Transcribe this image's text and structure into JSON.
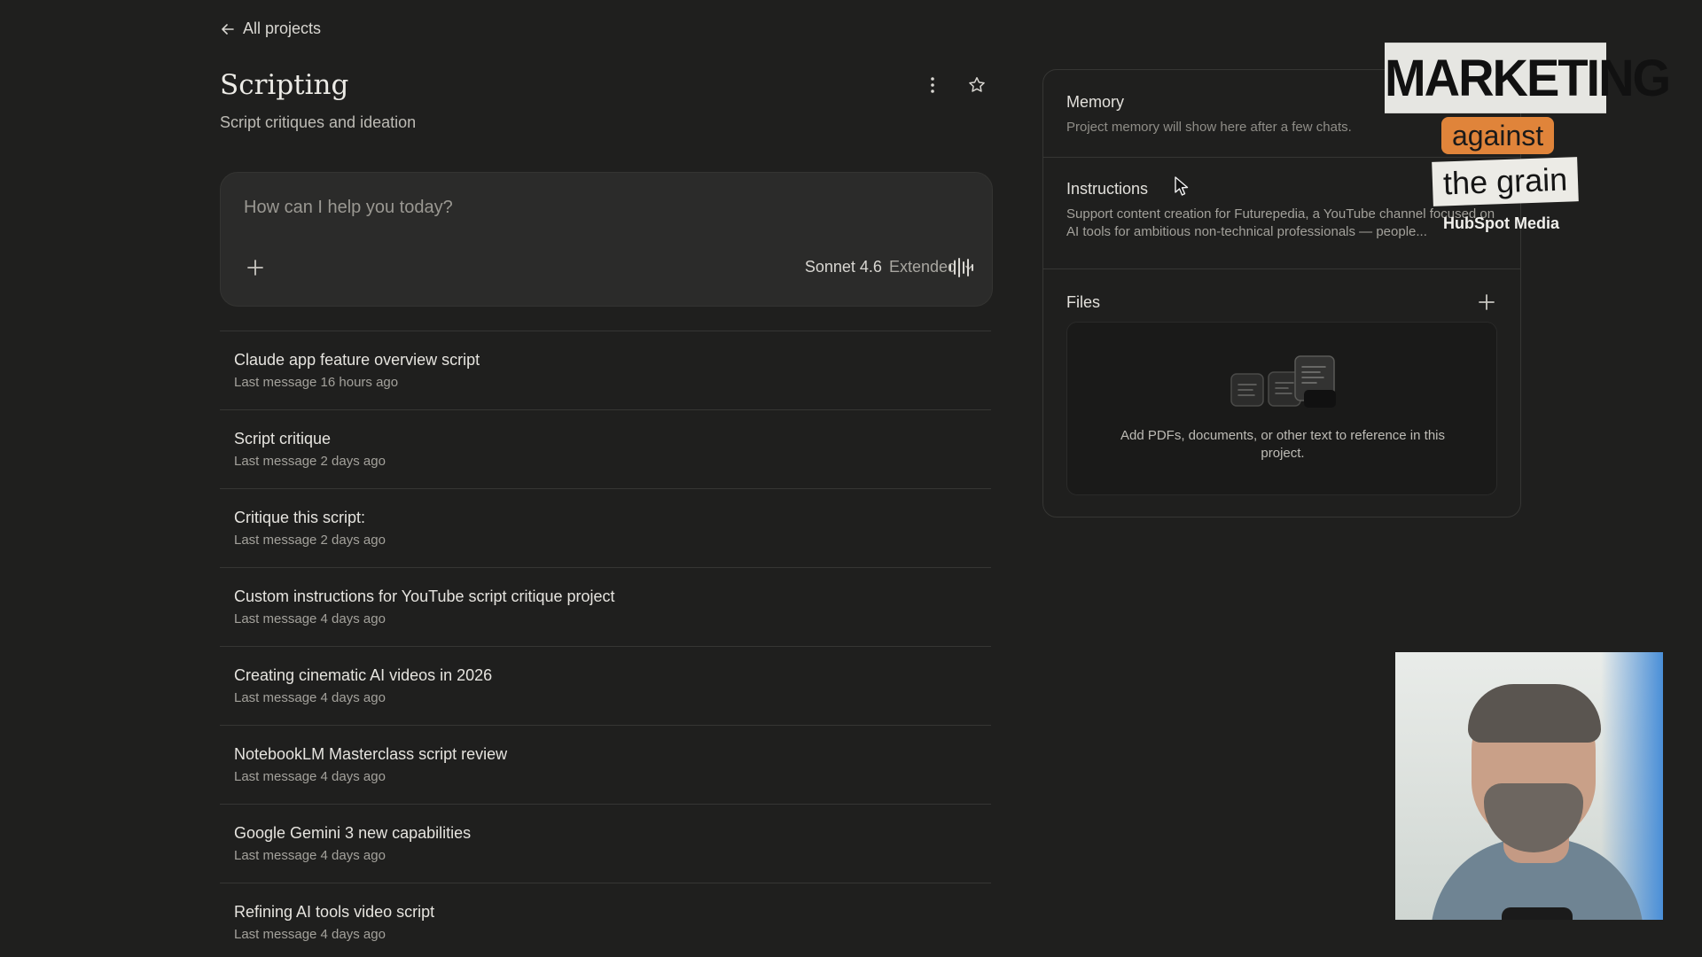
{
  "nav": {
    "back_label": "All projects"
  },
  "project": {
    "title": "Scripting",
    "description": "Script critiques and ideation"
  },
  "composer": {
    "placeholder": "How can I help you today?",
    "model_name": "Sonnet 4.6",
    "model_mode": "Extended"
  },
  "chats": [
    {
      "title": "Claude app feature overview script",
      "meta": "Last message 16 hours ago"
    },
    {
      "title": "Script critique",
      "meta": "Last message 2 days ago"
    },
    {
      "title": "Critique this script:",
      "meta": "Last message 2 days ago"
    },
    {
      "title": "Custom instructions for YouTube script critique project",
      "meta": "Last message 4 days ago"
    },
    {
      "title": "Creating cinematic AI videos in 2026",
      "meta": "Last message 4 days ago"
    },
    {
      "title": "NotebookLM Masterclass script review",
      "meta": "Last message 4 days ago"
    },
    {
      "title": "Google Gemini 3 new capabilities",
      "meta": "Last message 4 days ago"
    },
    {
      "title": "Refining AI tools video script",
      "meta": "Last message 4 days ago"
    }
  ],
  "sidebar": {
    "memory": {
      "label": "Memory",
      "text": "Project memory will show here after a few chats."
    },
    "instructions": {
      "label": "Instructions",
      "text": "Support content creation for Futurepedia, a YouTube channel focused on AI tools for ambitious non-technical professionals — people..."
    },
    "files": {
      "label": "Files",
      "empty_text": "Add PDFs, documents, or other text to reference in this project."
    }
  },
  "overlay": {
    "brand_main": "MARKETING",
    "brand_against": "against",
    "brand_grain": "the grain",
    "brand_publisher": "HubSpot Media"
  },
  "icons": {
    "back": "arrow-left-icon",
    "more": "more-vertical-icon",
    "star": "star-icon",
    "add": "plus-icon",
    "chevron": "chevron-down-icon",
    "voice": "audio-waveform-icon"
  }
}
